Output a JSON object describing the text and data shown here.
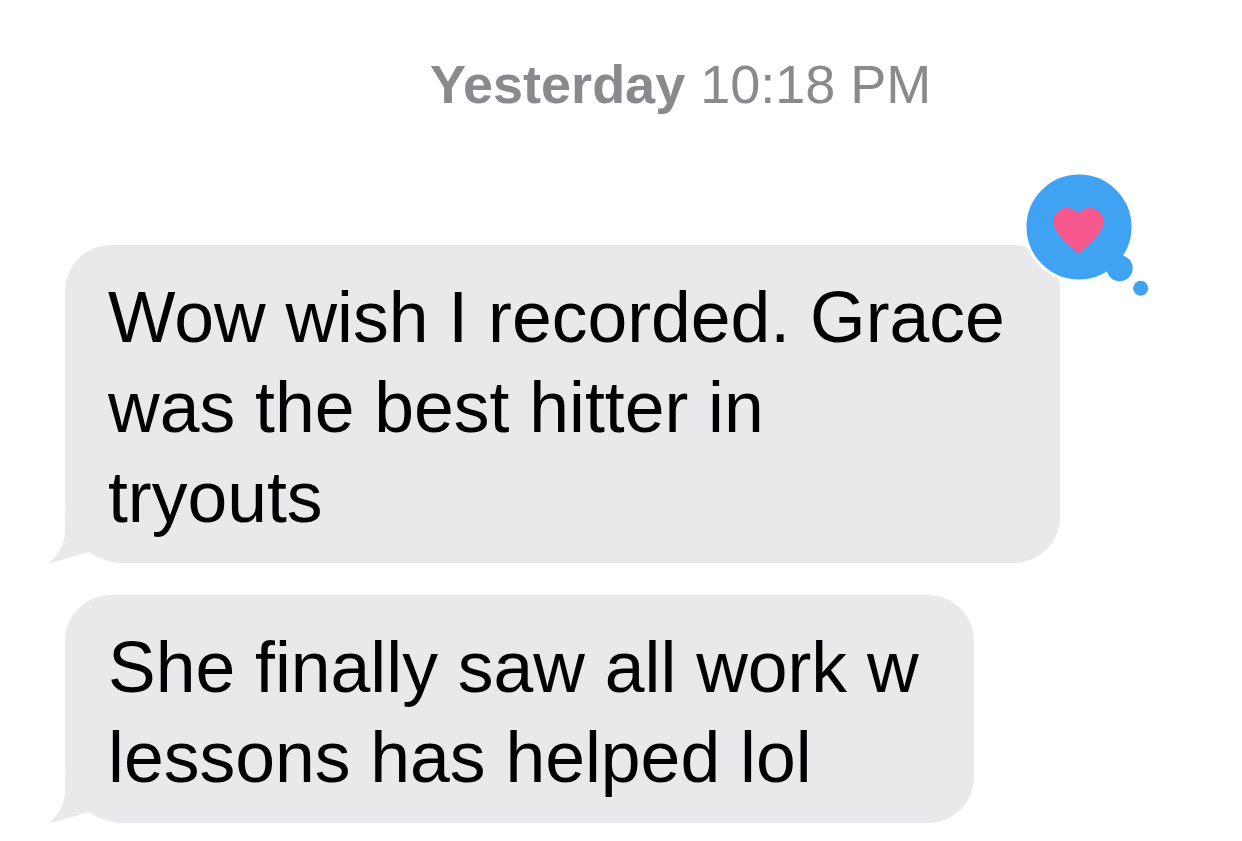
{
  "timestamp": "**Yesterday** 10:18 PM",
  "messages": [
    {
      "text": "Wow wish I recorded. Grace\nwas the best hitter in\ntryouts",
      "hearted": true
    },
    {
      "text": "She finally saw all work w\nlessons has helped lol",
      "hearted": false
    }
  ]
}
